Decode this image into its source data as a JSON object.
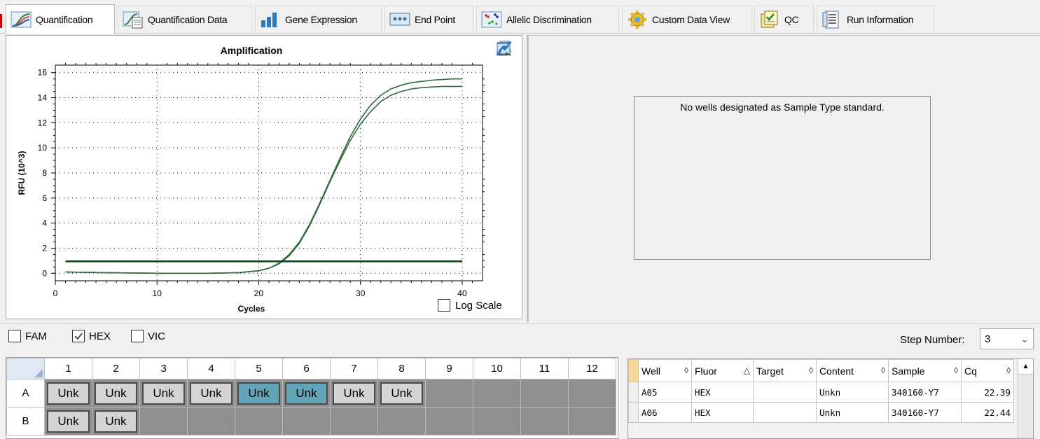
{
  "tabs": [
    {
      "label": "Quantification",
      "icon": "amplification-curve-icon",
      "active": true
    },
    {
      "label": "Quantification Data",
      "icon": "quant-data-icon",
      "active": false
    },
    {
      "label": "Gene Expression",
      "icon": "bar-chart-icon",
      "active": false
    },
    {
      "label": "End Point",
      "icon": "end-point-icon",
      "active": false
    },
    {
      "label": "Allelic Discrimination",
      "icon": "scatter-icon",
      "active": false
    },
    {
      "label": "Custom Data View",
      "icon": "gear-icon",
      "active": false
    },
    {
      "label": "QC",
      "icon": "qc-checklist-icon",
      "active": false
    },
    {
      "label": "Run Information",
      "icon": "document-icon",
      "active": false
    }
  ],
  "chart_data": {
    "type": "line",
    "title": "Amplification",
    "xlabel": "Cycles",
    "ylabel": "RFU (10^3)",
    "xlim": [
      0,
      42
    ],
    "ylim": [
      -0.6,
      16.6
    ],
    "xticks": [
      0,
      10,
      20,
      30,
      40
    ],
    "yticks": [
      0,
      2,
      4,
      6,
      8,
      10,
      12,
      14,
      16
    ],
    "grid": true,
    "series": [
      {
        "color": "#2e6b3a",
        "x": [
          1,
          5,
          10,
          15,
          18,
          20,
          21,
          22,
          23,
          24,
          25,
          26,
          27,
          28,
          29,
          30,
          31,
          32,
          33,
          34,
          35,
          36,
          37,
          38,
          39,
          40
        ],
        "y": [
          0.1,
          0.05,
          0.0,
          0.0,
          0.05,
          0.2,
          0.4,
          0.8,
          1.5,
          2.5,
          3.9,
          5.6,
          7.4,
          9.2,
          10.9,
          12.3,
          13.4,
          14.2,
          14.7,
          15.0,
          15.2,
          15.3,
          15.4,
          15.45,
          15.5,
          15.5
        ]
      },
      {
        "color": "#2e6b3a",
        "x": [
          1,
          5,
          10,
          15,
          18,
          20,
          21,
          22,
          23,
          24,
          25,
          26,
          27,
          28,
          29,
          30,
          31,
          32,
          33,
          34,
          35,
          36,
          37,
          38,
          39,
          40
        ],
        "y": [
          0.1,
          0.05,
          0.0,
          0.0,
          0.05,
          0.2,
          0.4,
          0.75,
          1.4,
          2.4,
          3.8,
          5.5,
          7.3,
          9.0,
          10.6,
          11.9,
          12.9,
          13.7,
          14.2,
          14.5,
          14.7,
          14.8,
          14.85,
          14.9,
          14.9,
          14.9
        ]
      }
    ],
    "threshold": {
      "y": 0.95,
      "color": "#0f3d14"
    }
  },
  "chart_tools": [
    "copy-icon",
    "export-icon",
    "save-image-icon",
    "chart-options-icon",
    "curve-fit-icon"
  ],
  "log_scale": {
    "label": "Log Scale",
    "checked": false
  },
  "standard_curve": {
    "message": "No wells designated as Sample Type standard."
  },
  "fluors": [
    {
      "label": "FAM",
      "checked": false
    },
    {
      "label": "HEX",
      "checked": true
    },
    {
      "label": "VIC",
      "checked": false
    }
  ],
  "step": {
    "label": "Step Number:",
    "value": "3"
  },
  "plate": {
    "columns": [
      "1",
      "2",
      "3",
      "4",
      "5",
      "6",
      "7",
      "8",
      "9",
      "10",
      "11",
      "12"
    ],
    "rows": [
      {
        "label": "A",
        "wells": [
          {
            "text": "Unk",
            "selected": false
          },
          {
            "text": "Unk",
            "selected": false
          },
          {
            "text": "Unk",
            "selected": false
          },
          {
            "text": "Unk",
            "selected": false
          },
          {
            "text": "Unk",
            "selected": true
          },
          {
            "text": "Unk",
            "selected": true
          },
          {
            "text": "Unk",
            "selected": false
          },
          {
            "text": "Unk",
            "selected": false
          },
          null,
          null,
          null,
          null
        ]
      },
      {
        "label": "B",
        "wells": [
          {
            "text": "Unk",
            "selected": false
          },
          {
            "text": "Unk",
            "selected": false
          },
          null,
          null,
          null,
          null,
          null,
          null,
          null,
          null,
          null,
          null
        ]
      }
    ]
  },
  "results": {
    "headers": [
      {
        "label": "Well",
        "sort": "◊"
      },
      {
        "label": "Fluor",
        "sort": "△"
      },
      {
        "label": "Target",
        "sort": "◊"
      },
      {
        "label": "Content",
        "sort": "◊"
      },
      {
        "label": "Sample",
        "sort": "◊"
      },
      {
        "label": "Cq",
        "sort": "◊"
      }
    ],
    "rows": [
      [
        "A05",
        "HEX",
        "",
        "Unkn",
        "340160-Y7",
        "22.39"
      ],
      [
        "A06",
        "HEX",
        "",
        "Unkn",
        "340160-Y7",
        "22.44"
      ]
    ]
  }
}
